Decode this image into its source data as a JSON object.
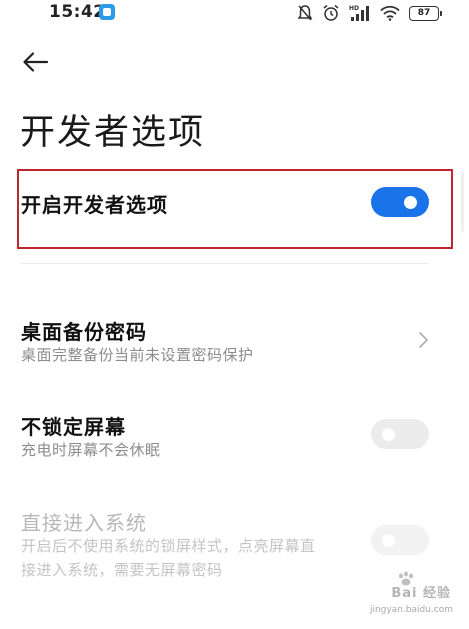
{
  "status_bar": {
    "time": "15:42",
    "battery": "87",
    "icons": [
      "app-notification-icon",
      "mute-icon",
      "alarm-icon",
      "hd-signal-icon",
      "wifi-icon",
      "battery-icon"
    ]
  },
  "header": {
    "back_icon": "back-arrow-icon",
    "title": "开发者选项"
  },
  "developer_toggle": {
    "label": "开启开发者选项",
    "state": "on"
  },
  "settings": [
    {
      "title": "桌面备份密码",
      "subtitle": "桌面完整备份当前未设置密码保护",
      "control": "chevron-right-icon",
      "enabled": true
    },
    {
      "title": "不锁定屏幕",
      "subtitle": "充电时屏幕不会休眠",
      "control": "switch",
      "state": "off",
      "enabled": true
    },
    {
      "title": "直接进入系统",
      "subtitle_lines": [
        "开启后不使用系统的锁屏样式，点亮屏幕直",
        "接进入系统，需要无屏幕密码"
      ],
      "control": "switch",
      "state": "off",
      "enabled": false
    }
  ],
  "watermark": {
    "logo_text": "Bai 经验",
    "url": "jingyan.baidu.com"
  },
  "colors": {
    "accent": "#1a73e8",
    "highlight_border": "#c0262d",
    "switch_off": "#ececec",
    "subtitle": "#8c8c8c",
    "disabled_text": "#b8b8b8"
  }
}
